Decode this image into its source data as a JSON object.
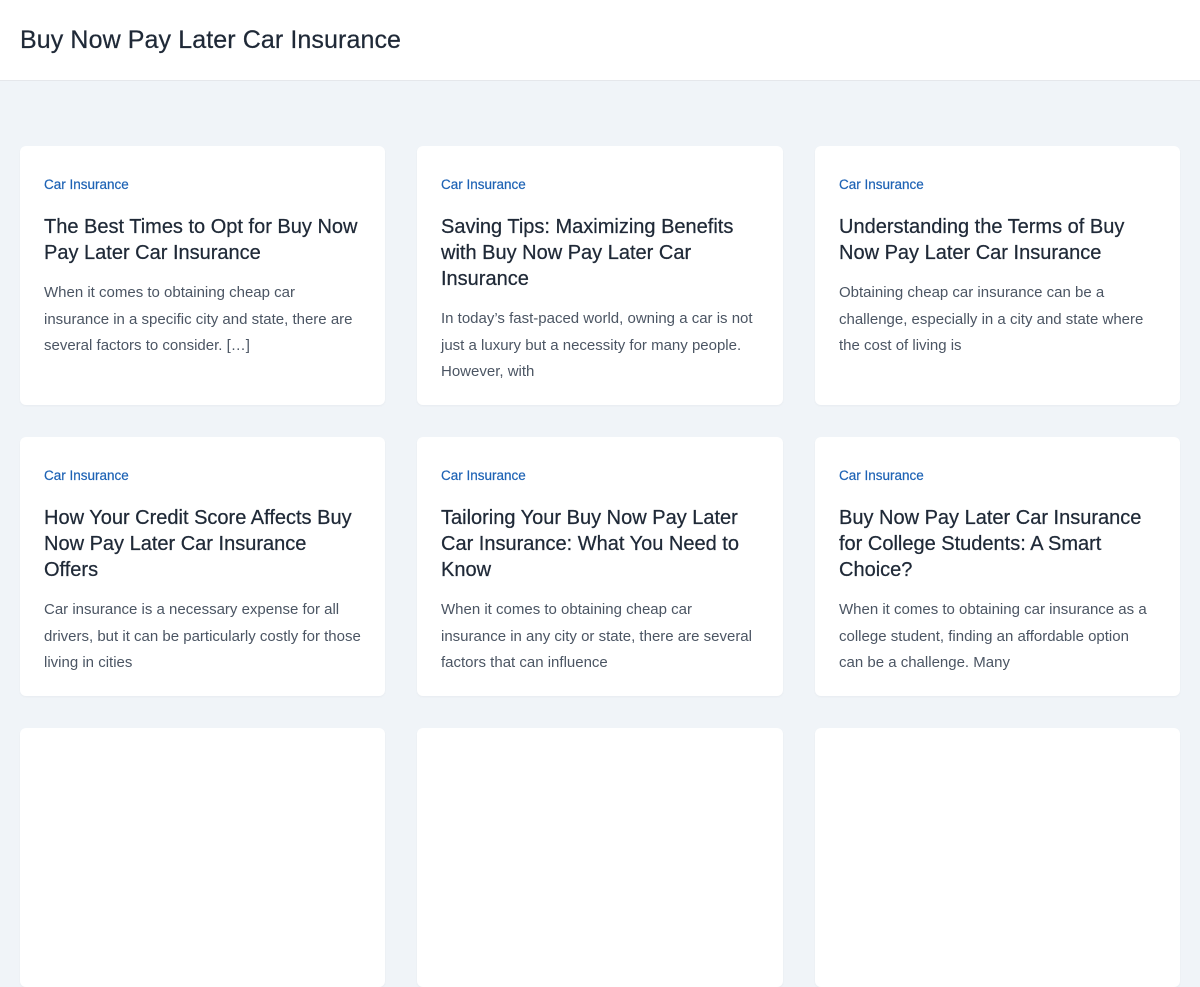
{
  "header": {
    "site_title": "Buy Now Pay Later Car Insurance"
  },
  "posts": [
    {
      "category": "Car Insurance",
      "title": "The Best Times to Opt for Buy Now Pay Later Car Insurance",
      "excerpt": "When it comes to obtaining cheap car insurance in a specific city and state, there are several factors to consider. […]"
    },
    {
      "category": "Car Insurance",
      "title": "Saving Tips: Maximizing Benefits with Buy Now Pay Later Car Insurance",
      "excerpt": "In today’s fast-paced world, owning a car is not just a luxury but a necessity for many people. However, with"
    },
    {
      "category": "Car Insurance",
      "title": "Understanding the Terms of Buy Now Pay Later Car Insurance",
      "excerpt": "Obtaining cheap car insurance can be a challenge, especially in a city and state where the cost of living is"
    },
    {
      "category": "Car Insurance",
      "title": "How Your Credit Score Affects Buy Now Pay Later Car Insurance Offers",
      "excerpt": "Car insurance is a necessary expense for all drivers, but it can be particularly costly for those living in cities"
    },
    {
      "category": "Car Insurance",
      "title": "Tailoring Your Buy Now Pay Later Car Insurance: What You Need to Know",
      "excerpt": "When it comes to obtaining cheap car insurance in any city or state, there are several factors that can influence"
    },
    {
      "category": "Car Insurance",
      "title": "Buy Now Pay Later Car Insurance for College Students: A Smart Choice?",
      "excerpt": "When it comes to obtaining car insurance as a college student, finding an affordable option can be a challenge. Many"
    }
  ],
  "colors": {
    "page_background": "#f0f4f8",
    "card_background": "#ffffff",
    "category_link": "#1e63b5",
    "title_text": "#1f2937",
    "excerpt_text": "#4b5563"
  }
}
